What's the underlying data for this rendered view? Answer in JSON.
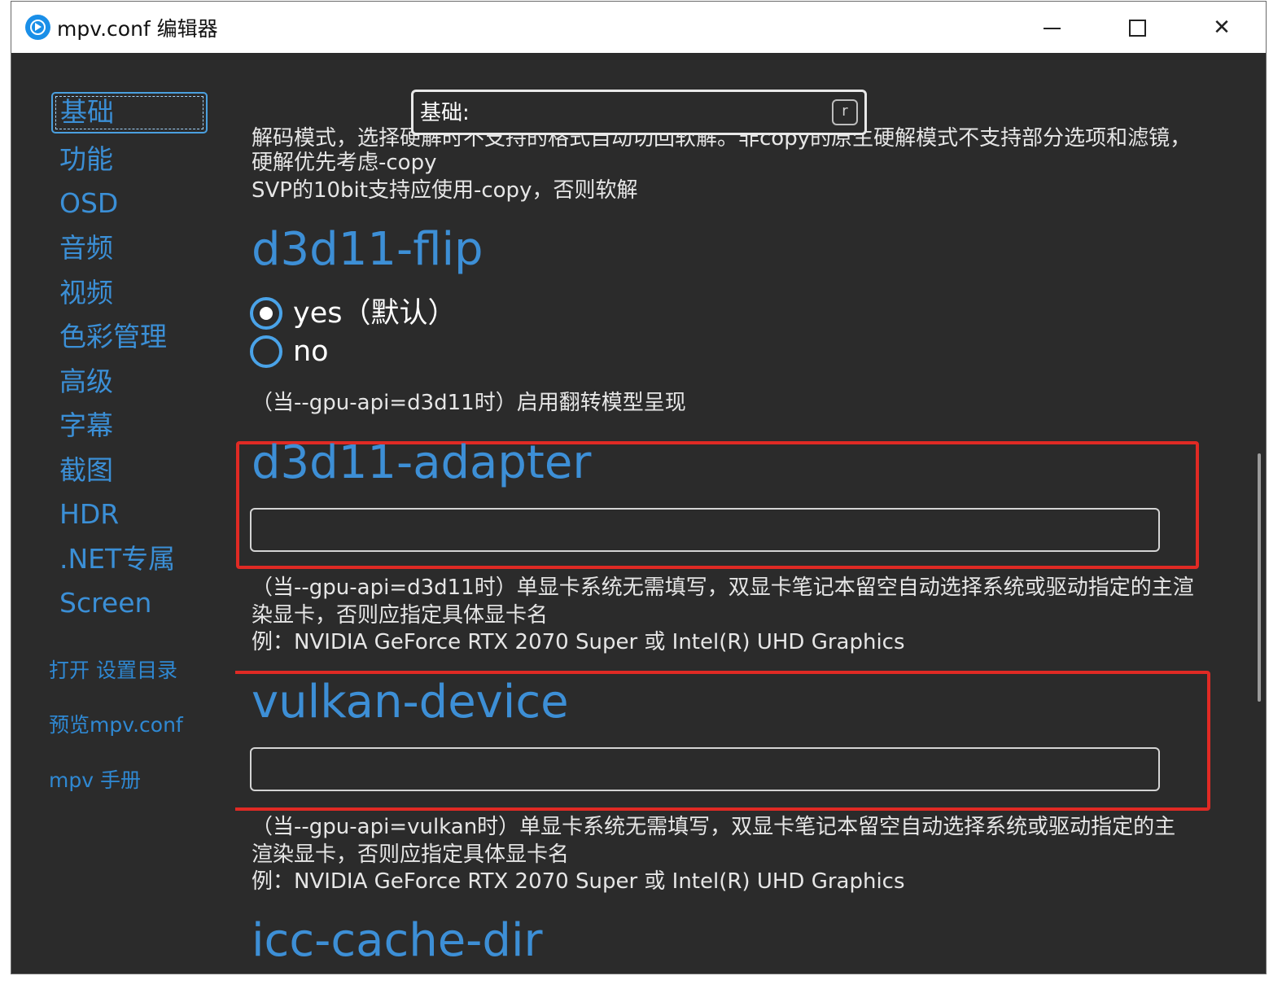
{
  "window": {
    "title": "mpv.conf 编辑器"
  },
  "search": {
    "placeholder": "基础:",
    "shortcut": "r"
  },
  "sidebar": {
    "items": [
      {
        "label": "基础"
      },
      {
        "label": "功能"
      },
      {
        "label": "OSD"
      },
      {
        "label": "音频"
      },
      {
        "label": "视频"
      },
      {
        "label": "色彩管理"
      },
      {
        "label": "高级"
      },
      {
        "label": "字幕"
      },
      {
        "label": "截图"
      },
      {
        "label": "HDR"
      },
      {
        "label": ".NET专属"
      },
      {
        "label": "Screen"
      }
    ],
    "links": [
      {
        "label": "打开 设置目录"
      },
      {
        "label": "预览mpv.conf"
      },
      {
        "label": "mpv 手册"
      }
    ]
  },
  "content": {
    "hwdec_desc_line1": "解码模式，选择硬解时不支持的格式自动切回软解。非copy的原生硬解模式不支持部分选项和滤镜，",
    "hwdec_desc_line2": "硬解优先考虑-copy",
    "hwdec_desc_line3": "SVP的10bit支持应使用-copy，否则软解",
    "d3d11_flip": {
      "title": "d3d11-flip",
      "options": [
        {
          "label": "yes（默认）",
          "checked": true
        },
        {
          "label": "no",
          "checked": false
        }
      ],
      "desc": "（当--gpu-api=d3d11时）启用翻转模型呈现"
    },
    "d3d11_adapter": {
      "title": "d3d11-adapter",
      "value": "",
      "desc_line1": "（当--gpu-api=d3d11时）单显卡系统无需填写，双显卡笔记本留空自动选择系统或驱动指定的主渲",
      "desc_line2": "染显卡，否则应指定具体显卡名",
      "desc_line3": "例：NVIDIA GeForce RTX 2070 Super 或 Intel(R) UHD Graphics"
    },
    "vulkan_device": {
      "title": "vulkan-device",
      "value": "",
      "desc_line1": "（当--gpu-api=vulkan时）单显卡系统无需填写，双显卡笔记本留空自动选择系统或驱动指定的主",
      "desc_line2": "渲染显卡，否则应指定具体显卡名",
      "desc_line3": "例：NVIDIA GeForce RTX 2070 Super 或 Intel(R) UHD Graphics"
    },
    "icc_cache_dir": {
      "title": "icc-cache-dir"
    }
  },
  "colors": {
    "accent": "#3d8fd6",
    "highlight": "#e02a24",
    "background": "#2b2b2b"
  }
}
